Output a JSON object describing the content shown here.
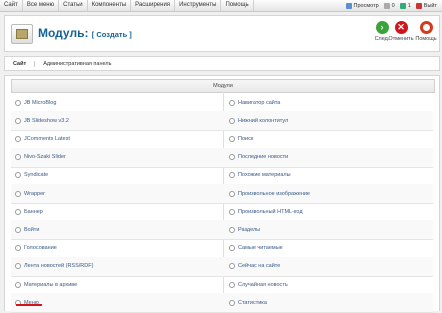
{
  "menubar": {
    "items": [
      "Сайт",
      "Все меню",
      "Статьи",
      "Компоненты",
      "Расширения",
      "Инструменты",
      "Помощь"
    ],
    "status": {
      "preview": "Просмотр",
      "messages": "0",
      "users": "1",
      "logout": "Выйт"
    }
  },
  "header": {
    "title": "Модуль:",
    "subtitle": "[ Создать ]",
    "toolbar": {
      "next": "След.",
      "cancel": "Отменить",
      "help": "Помощь"
    }
  },
  "tabs": [
    "Сайт",
    "Административная панель"
  ],
  "panel": {
    "title": "Модули",
    "left": [
      "JB MicroBlog",
      "JB Slideshow v3.2",
      "JComments Latest",
      "Nivo-Szaki Slider",
      "Syndicate",
      "Wrapper",
      "Баннер",
      "Войти",
      "Голосование",
      "Лента новостей (RSS/RDF)",
      "Материалы в архиве",
      "Меню"
    ],
    "right": [
      "Навигатор сайта",
      "Нижний колонтитул",
      "Поиск",
      "Последние новости",
      "Похожие материалы",
      "Произвольное изображение",
      "Произвольный HTML-код",
      "Разделы",
      "Самые читаемые",
      "Сейчас на сайте",
      "Случайная новость",
      "Статистика"
    ]
  },
  "colors": {
    "accent": "#146295",
    "link": "#3b5a86",
    "next": "#3aa33a",
    "cancel": "#d0141c",
    "help": "#d23b1a"
  }
}
